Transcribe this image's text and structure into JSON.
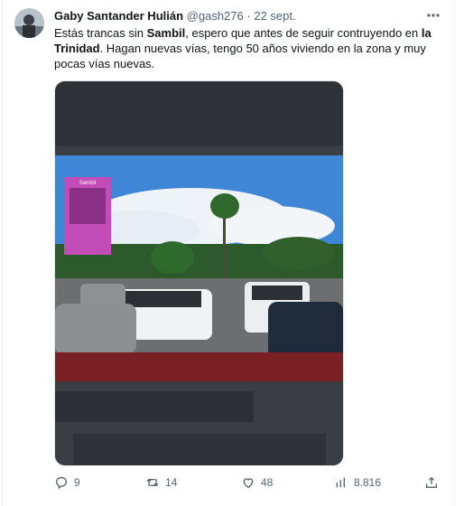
{
  "tweet": {
    "author_name": "Gaby Santander Hulián",
    "handle": "@gash276",
    "separator": "·",
    "date": "22 sept.",
    "text_segments": [
      {
        "text": "Estás trancas sin ",
        "bold": false
      },
      {
        "text": "Sambil",
        "bold": true
      },
      {
        "text": ", espero que antes de seguir contruyendo en ",
        "bold": false
      },
      {
        "text": "la Trinidad",
        "bold": true
      },
      {
        "text": ". Hagan nuevas vías, tengo 50 años viviendo en la zona y muy pocas vías nuevas.",
        "bold": false
      }
    ],
    "billboard_text": "Sambil"
  },
  "actions": {
    "replies": "9",
    "retweets": "14",
    "likes": "48",
    "views": "8.816"
  },
  "icons": {
    "more": "more-dots-icon",
    "reply": "reply-icon",
    "retweet": "retweet-icon",
    "like": "heart-icon",
    "views": "views-chart-icon",
    "share": "share-icon"
  },
  "colors": {
    "text": "#0f1419",
    "muted": "#536471",
    "sky": "#3f86d6"
  }
}
